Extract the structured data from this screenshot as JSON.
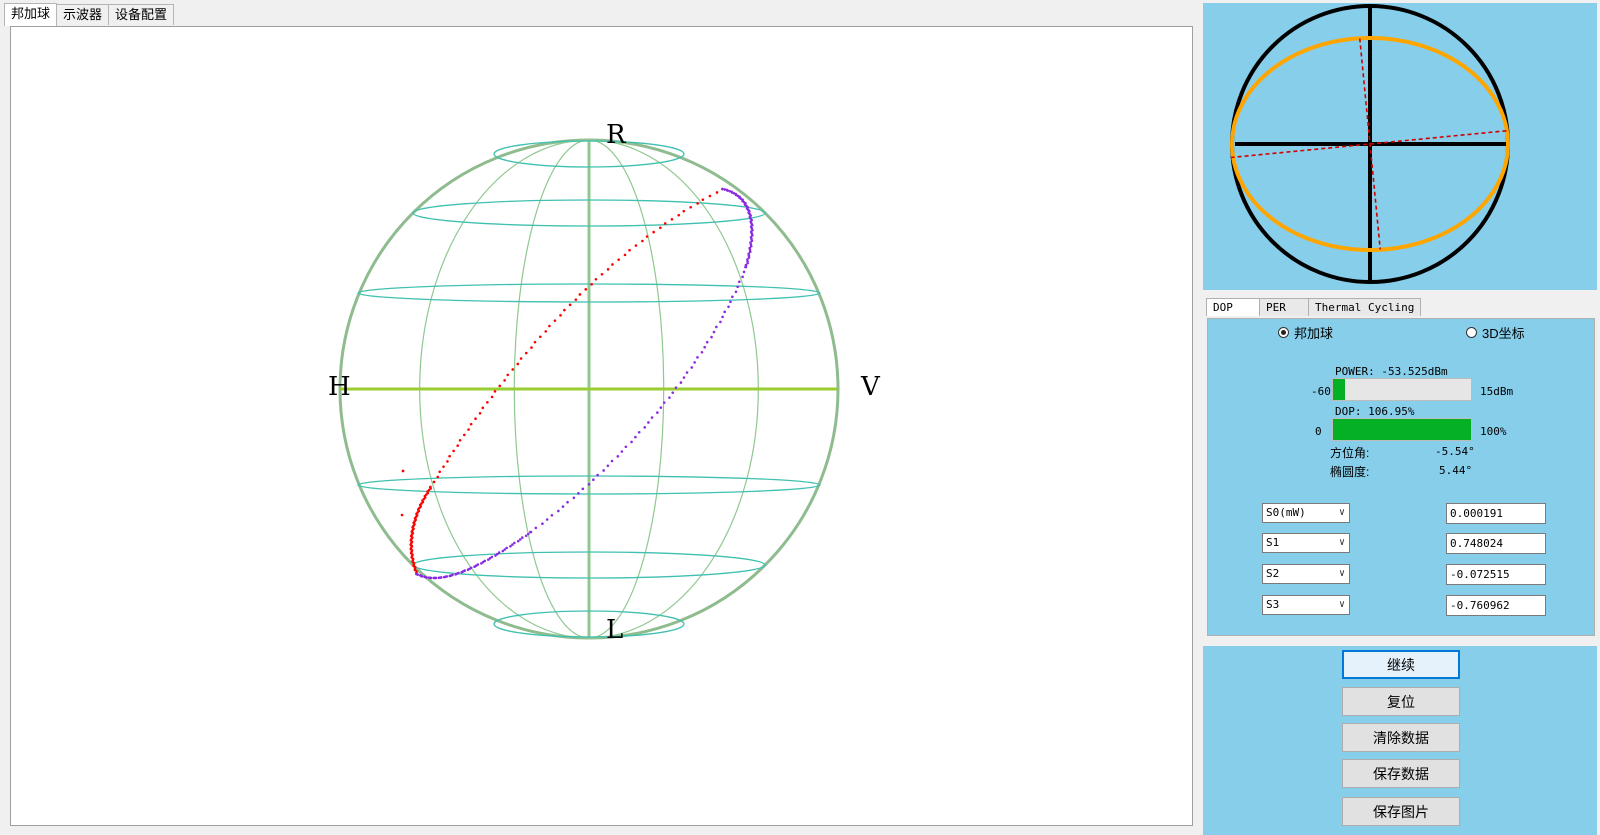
{
  "main_tabs": [
    "邦加球",
    "示波器",
    "设备配置"
  ],
  "sphere": {
    "pole_labels": {
      "top": "R",
      "bottom": "L",
      "left": "H",
      "right": "V"
    },
    "colors": {
      "outline": "#8fbc8f",
      "latitude": "#40c0b0",
      "meridian": "#90c890",
      "equator": "#9acd32",
      "trace_red": "#ff0000",
      "trace_purple": "#8a2be2"
    }
  },
  "ellipse_view": {
    "azimuth_deg": -5.54,
    "ellipticity_deg": 5.44,
    "colors": {
      "circle": "#000000",
      "ellipse": "#ffa500",
      "axis": "#d00000",
      "background": "#87ceeb"
    }
  },
  "side_tabs": [
    "DOP",
    "PER",
    "Thermal Cycling"
  ],
  "dop": {
    "radio_poincare": "邦加球",
    "radio_3d": "3D坐标",
    "power_label": "POWER: -53.525dBm",
    "power_min": "-60",
    "power_max": "15dBm",
    "power_fraction": 0.086,
    "dop_label": "DOP: 106.95%",
    "dop_min": "0",
    "dop_max": "100%",
    "dop_fraction": 1.0,
    "azimuth_label": "方位角:",
    "azimuth_value": "-5.54°",
    "ellipticity_label": "椭圆度:",
    "ellipticity_value": "5.44°"
  },
  "stokes": [
    {
      "name": "S0(mW)",
      "value": "0.000191"
    },
    {
      "name": "S1",
      "value": "0.748024"
    },
    {
      "name": "S2",
      "value": "-0.072515"
    },
    {
      "name": "S3",
      "value": "-0.760962"
    }
  ],
  "buttons": {
    "continue": "继续",
    "reset": "复位",
    "clear": "清除数据",
    "save_data": "保存数据",
    "save_image": "保存图片"
  }
}
